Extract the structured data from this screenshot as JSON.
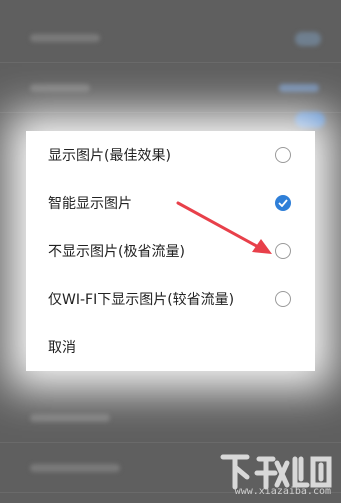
{
  "dialog": {
    "options": [
      {
        "label": "显示图片(最佳效果)",
        "selected": false
      },
      {
        "label": "智能显示图片",
        "selected": true
      },
      {
        "label": "不显示图片(极省流量)",
        "selected": false
      },
      {
        "label": "仅WI-FI下显示图片(较省流量)",
        "selected": false
      }
    ],
    "cancel_label": "取消"
  },
  "colors": {
    "accent": "#2f7fd8",
    "annotation_arrow": "#e8404a"
  },
  "watermark": {
    "text": "www.xiazaiba.com"
  }
}
